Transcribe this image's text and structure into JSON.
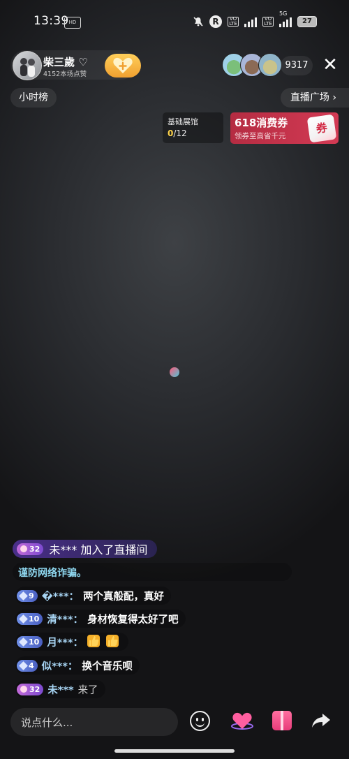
{
  "status_bar": {
    "time": "13:39",
    "app_badge": "HD",
    "r_badge": "R",
    "volte": "Vo\nLTE",
    "net": "5G",
    "battery": "27"
  },
  "host": {
    "name": "柴三歲 ♡",
    "likes": "4152本场点赞"
  },
  "viewers": {
    "count": "9317"
  },
  "top": {
    "hour_rank": "小时榜",
    "live_plaza": "直播广场 ›"
  },
  "gallery": {
    "title": "基础展馆",
    "progress_current": "0",
    "progress_total": "/12"
  },
  "coupon": {
    "title": "618消费券",
    "subtitle": "领券至高省千元",
    "icon_text": "券"
  },
  "chat": {
    "join": {
      "level": "32",
      "text": "未*** 加入了直播间"
    },
    "notice": "谨防网络诈骗。",
    "messages": [
      {
        "level": "9",
        "user": "�***：",
        "body": "两个真般配，真好"
      },
      {
        "level": "10",
        "user": "清***：",
        "body": "身材恢复得太好了吧"
      },
      {
        "level": "10",
        "user": "月***：",
        "body": ""
      },
      {
        "level": "4",
        "user": "似***：",
        "body": "换个音乐呗"
      },
      {
        "level": "32",
        "user": "未***",
        "body": "来了"
      }
    ]
  },
  "bottom": {
    "placeholder": "说点什么..."
  },
  "colors": {
    "accent_gold": "#ffd44a",
    "coupon_red": "#c9334b",
    "chat_user": "#a7d4f3",
    "notice": "#8fd8f0"
  }
}
